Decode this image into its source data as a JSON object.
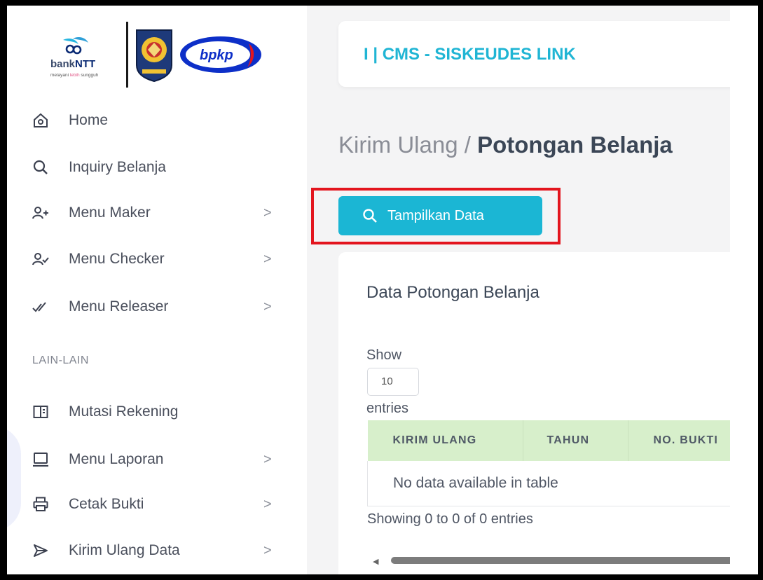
{
  "brand": {
    "bank_name_prefix": "bank",
    "bank_name_suffix": "NTT",
    "tagline_a": "melayani ",
    "tagline_b": "lebih",
    "tagline_c": " sungguh",
    "partner_logo_text": "bpkp"
  },
  "sidebar": {
    "items": [
      {
        "label": "Home",
        "icon": "home-icon",
        "has_submenu": false
      },
      {
        "label": "Inquiry Belanja",
        "icon": "search-icon",
        "has_submenu": false
      },
      {
        "label": "Menu Maker",
        "icon": "user-add-icon",
        "has_submenu": true
      },
      {
        "label": "Menu Checker",
        "icon": "user-check-icon",
        "has_submenu": true
      },
      {
        "label": "Menu Releaser",
        "icon": "double-check-icon",
        "has_submenu": true
      }
    ],
    "section_label": "LAIN-LAIN",
    "items2": [
      {
        "label": "Mutasi Rekening",
        "icon": "book-icon",
        "has_submenu": false
      },
      {
        "label": "Menu Laporan",
        "icon": "laptop-icon",
        "has_submenu": true
      },
      {
        "label": "Cetak Bukti",
        "icon": "printer-icon",
        "has_submenu": true
      },
      {
        "label": "Kirim Ulang Data",
        "icon": "send-icon",
        "has_submenu": true
      }
    ],
    "chevron": ">"
  },
  "header": {
    "app_title": "I | CMS - SISKEUDES LINK"
  },
  "breadcrumb": {
    "parent": "Kirim Ulang",
    "separator": " / ",
    "current": "Potongan Belanja"
  },
  "actions": {
    "show_data_label": "Tampilkan Data"
  },
  "table_card": {
    "title": "Data Potongan Belanja",
    "show_label": "Show",
    "entries_value": "10",
    "entries_label": "entries",
    "columns": [
      "KIRIM ULANG",
      "TAHUN",
      "NO. BUKTI"
    ],
    "empty_message": "No data available in table",
    "info": "Showing 0 to 0 of 0 entries"
  },
  "colors": {
    "accent": "#1bb6d4",
    "title_accent": "#20b5d4",
    "table_header_bg": "#d7efcb",
    "highlight_border": "#e3151e"
  }
}
